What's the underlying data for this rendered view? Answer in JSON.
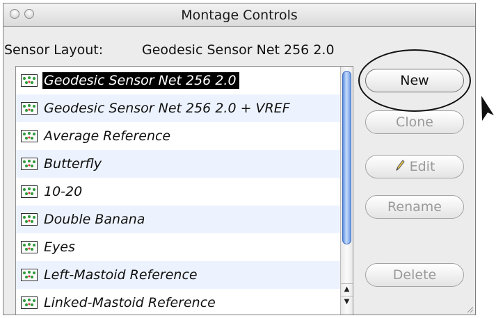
{
  "window": {
    "title": "Montage Controls"
  },
  "sensor_layout": {
    "label": "Sensor Layout:",
    "value": "Geodesic Sensor Net 256 2.0"
  },
  "montages": [
    {
      "label": "Geodesic Sensor Net 256 2.0",
      "selected": true
    },
    {
      "label": "Geodesic Sensor Net 256 2.0 + VREF"
    },
    {
      "label": "Average Reference"
    },
    {
      "label": "Butterfly"
    },
    {
      "label": "10-20"
    },
    {
      "label": "Double Banana"
    },
    {
      "label": "Eyes"
    },
    {
      "label": "Left-Mastoid Reference"
    },
    {
      "label": "Linked-Mastoid Reference"
    }
  ],
  "buttons": {
    "new": "New",
    "clone": "Clone",
    "edit": "Edit",
    "rename": "Rename",
    "delete": "Delete"
  },
  "icons": {
    "montage_icon": "montage-layout-icon",
    "edit_icon": "pencil-icon"
  },
  "colors": {
    "selection": "#000000",
    "alternate_row": "#edf3fe",
    "scroll_thumb": "#5d8fe0"
  }
}
